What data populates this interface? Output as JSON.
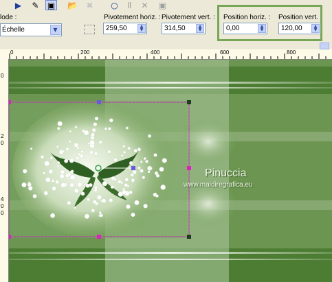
{
  "toolbar": {
    "mode_label": "lode :",
    "mode_value": "Échelle",
    "pivot_h_label": "Pivotement horiz. :",
    "pivot_h_value": "259,50",
    "pivot_v_label": "Pivotement vert. :",
    "pivot_v_value": "314,50",
    "pos_h_label": "Position horiz. :",
    "pos_h_value": "0,00",
    "pos_v_label": "Position vert. :",
    "pos_v_value": "120,00"
  },
  "ruler": {
    "h_labels": [
      "0",
      "200",
      "400",
      "600",
      "800"
    ],
    "v_labels": [
      "0",
      "2",
      "0",
      "4",
      "0",
      "0"
    ]
  },
  "canvas": {
    "watermark_title": "Pinuccia",
    "watermark_url": "www.maidiregrafica.eu"
  },
  "colors": {
    "highlight": "#77a657",
    "selection": "#e020c0",
    "handle": "#1f3d1f"
  }
}
